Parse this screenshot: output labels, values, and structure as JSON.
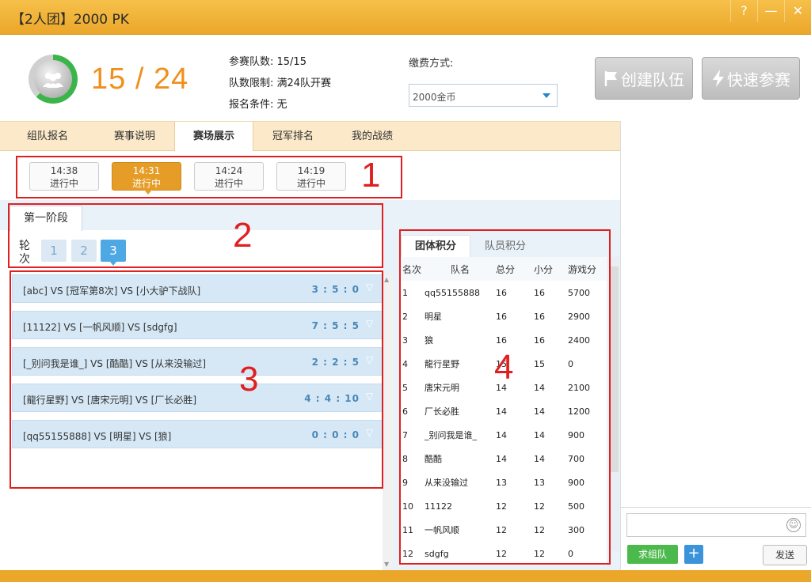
{
  "window": {
    "title": "【2人团】2000 PK",
    "controls": {
      "help": "?",
      "minimize": "—",
      "close": "✕"
    }
  },
  "header": {
    "count": "15 / 24",
    "info_lines": [
      "参赛队数: 15/15",
      "队数限制: 满24队开赛",
      "报名条件: 无"
    ],
    "pay_label": "缴费方式:",
    "pay_selected": "2000金币",
    "create_team_label": "创建队伍",
    "quick_join_label": "快速参赛"
  },
  "tabs": [
    {
      "label": "组队报名",
      "active": false
    },
    {
      "label": "赛事说明",
      "active": false
    },
    {
      "label": "赛场展示",
      "active": true
    },
    {
      "label": "冠军排名",
      "active": false
    },
    {
      "label": "我的战绩",
      "active": false
    }
  ],
  "time_slots": [
    {
      "time": "14:38",
      "status": "进行中",
      "active": false
    },
    {
      "time": "14:31",
      "status": "进行中",
      "active": true
    },
    {
      "time": "14:24",
      "status": "进行中",
      "active": false
    },
    {
      "time": "14:19",
      "status": "进行中",
      "active": false
    }
  ],
  "stage": {
    "label": "第一阶段",
    "round_label": "轮次",
    "rounds": [
      {
        "label": "1",
        "active": false
      },
      {
        "label": "2",
        "active": false
      },
      {
        "label": "3",
        "active": true
      }
    ]
  },
  "matches": [
    {
      "teams": "[abc] VS [冠军第8次] VS [小大驴下战队]",
      "score": "3 : 5 : 0"
    },
    {
      "teams": "[11122] VS [一帆风顺] VS [sdgfg]",
      "score": "7 : 5 : 5"
    },
    {
      "teams": "[_别问我是谁_] VS [酷酷] VS [从来没输过]",
      "score": "2 : 2 : 5"
    },
    {
      "teams": "[龍行星野] VS [唐宋元明] VS [厂长必胜]",
      "score": "4 : 4 : 10"
    },
    {
      "teams": "[qq55155888] VS [明星] VS [狼]",
      "score": "0 : 0 : 0"
    }
  ],
  "standings": {
    "tabs": [
      {
        "label": "团体积分",
        "active": true
      },
      {
        "label": "队员积分",
        "active": false
      }
    ],
    "columns": [
      "名次",
      "队名",
      "总分",
      "小分",
      "游戏分"
    ],
    "rows": [
      [
        "1",
        "qq55155888",
        "16",
        "16",
        "5700"
      ],
      [
        "2",
        "明星",
        "16",
        "16",
        "2900"
      ],
      [
        "3",
        "狼",
        "16",
        "16",
        "2400"
      ],
      [
        "4",
        "龍行星野",
        "15",
        "15",
        "0"
      ],
      [
        "5",
        "唐宋元明",
        "14",
        "14",
        "2100"
      ],
      [
        "6",
        "厂长必胜",
        "14",
        "14",
        "1200"
      ],
      [
        "7",
        "_别问我是谁_",
        "14",
        "14",
        "900"
      ],
      [
        "8",
        "酷酷",
        "14",
        "14",
        "700"
      ],
      [
        "9",
        "从来没输过",
        "13",
        "13",
        "900"
      ],
      [
        "10",
        "11122",
        "12",
        "12",
        "500"
      ],
      [
        "11",
        "一帆风顺",
        "12",
        "12",
        "300"
      ],
      [
        "12",
        "sdgfg",
        "12",
        "12",
        "0"
      ]
    ]
  },
  "chat": {
    "team_button": "求组队",
    "plus_button": "+",
    "send_button": "发送"
  },
  "annotations": [
    "1",
    "2",
    "3",
    "4"
  ],
  "colors": {
    "titlebar": "#eba72a",
    "count": "#f0901c",
    "active_time": "#e69d28",
    "active_round": "#4ea8e4",
    "annotation": "#e02020"
  }
}
